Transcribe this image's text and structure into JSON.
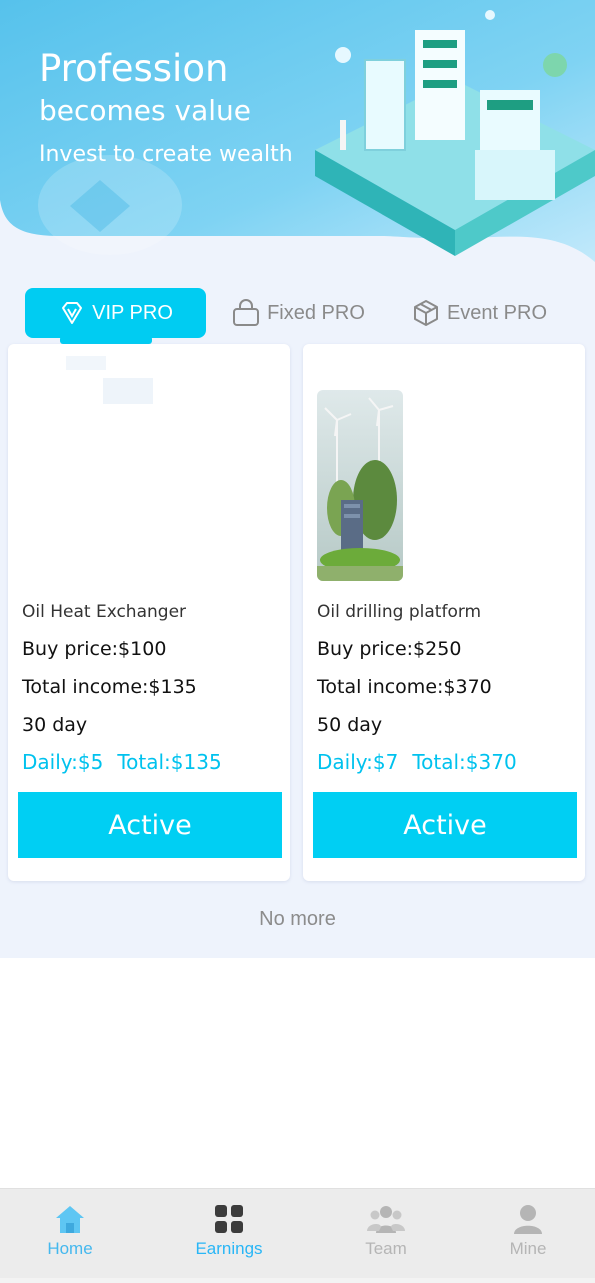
{
  "banner": {
    "title": "Profession",
    "subtitle": "becomes value",
    "tagline": "Invest to create wealth"
  },
  "tabs": [
    {
      "label": "VIP PRO",
      "icon": "diamond-v-icon",
      "active": true
    },
    {
      "label": "Fixed PRO",
      "icon": "bag-icon",
      "active": false
    },
    {
      "label": "Event PRO",
      "icon": "box-icon",
      "active": false
    }
  ],
  "products": [
    {
      "name": "Oil Heat Exchanger",
      "buy_price": "Buy price:$100",
      "total_income": "Total income:$135",
      "period": "30 day",
      "daily": "Daily:$5",
      "total": "Total:$135",
      "button": "Active"
    },
    {
      "name": "Oil drilling platform",
      "buy_price": "Buy price:$250",
      "total_income": "Total income:$370",
      "period": "50 day",
      "daily": "Daily:$7",
      "total": "Total:$370",
      "button": "Active"
    }
  ],
  "list_end": "No more",
  "nav": [
    {
      "label": "Home",
      "icon": "home-icon",
      "color": "#4fc3f7"
    },
    {
      "label": "Earnings",
      "icon": "grid-icon",
      "color": "#29b6f6"
    },
    {
      "label": "Team",
      "icon": "team-icon",
      "color": "#b5b5b5"
    },
    {
      "label": "Mine",
      "icon": "user-icon",
      "color": "#b5b5b5"
    }
  ],
  "colors": {
    "accent": "#00ccf2",
    "stats_text": "#00c2ee",
    "banner_gradient_start": "#5ec8ee",
    "banner_gradient_end": "#b9e6fa"
  }
}
